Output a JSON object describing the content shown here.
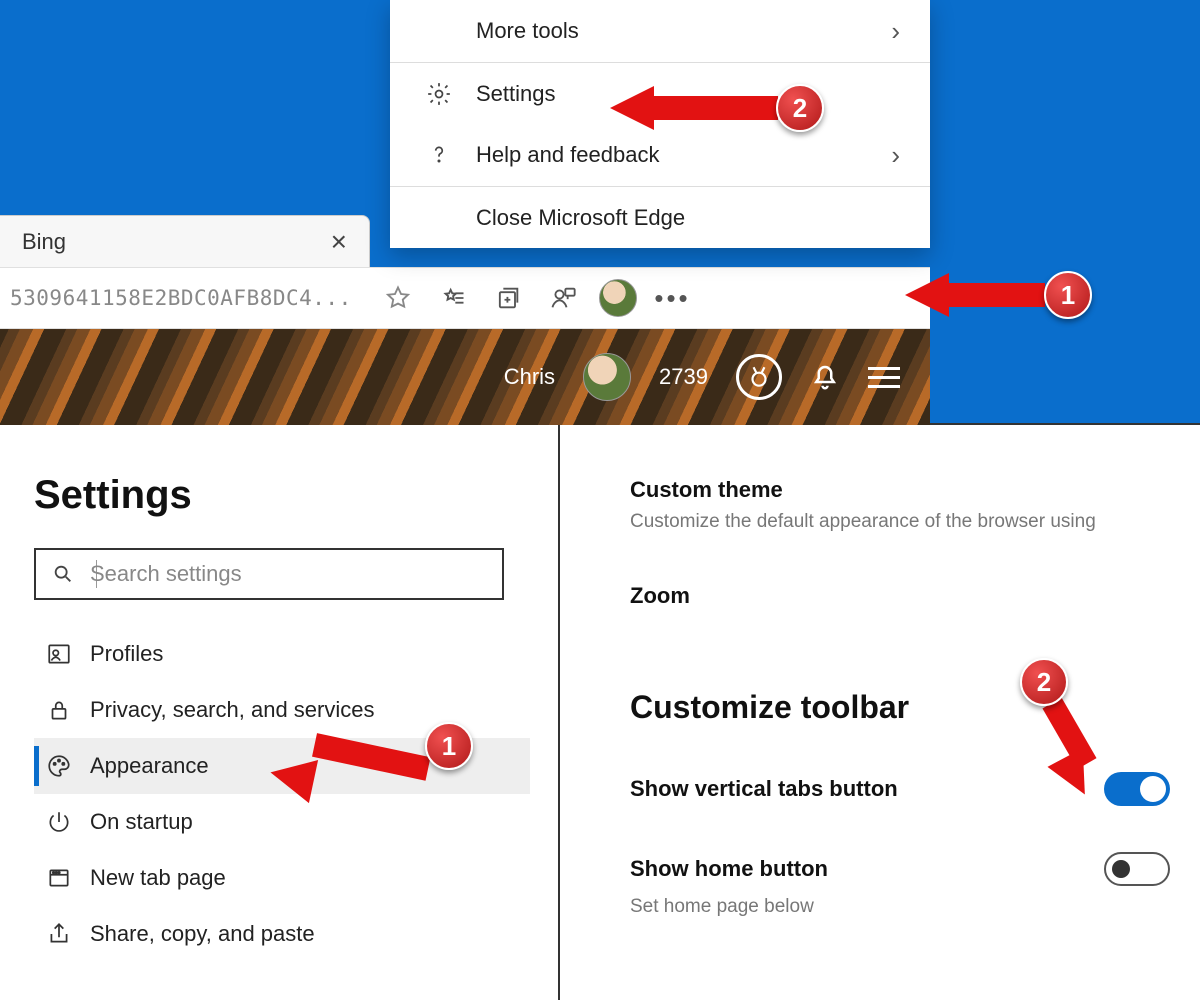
{
  "colors": {
    "accent": "#0a6ecc",
    "annotation": "#e21212"
  },
  "browser": {
    "tab_title": "Bing",
    "address_fragment": "5309641158E2BDC0AFB8DC4...",
    "menu": {
      "more_tools": "More tools",
      "settings": "Settings",
      "help_feedback": "Help and feedback",
      "close_edge": "Close Microsoft Edge"
    },
    "banner": {
      "user_name": "Chris",
      "rewards_points": "2739"
    }
  },
  "annotations": {
    "upper_step1": "1",
    "upper_step2": "2",
    "lower_step1": "1",
    "lower_step2": "2"
  },
  "settings": {
    "title": "Settings",
    "search_placeholder": "Search settings",
    "nav": {
      "profiles": "Profiles",
      "privacy": "Privacy, search, and services",
      "appearance": "Appearance",
      "on_startup": "On startup",
      "new_tab_page": "New tab page",
      "share_copy_paste": "Share, copy, and paste"
    },
    "right": {
      "custom_theme_title": "Custom theme",
      "custom_theme_desc": "Customize the default appearance of the browser using",
      "zoom_title": "Zoom",
      "customize_toolbar_title": "Customize toolbar",
      "show_vertical_tabs": "Show vertical tabs button",
      "show_home_button": "Show home button",
      "show_home_sub": "Set home page below"
    }
  }
}
